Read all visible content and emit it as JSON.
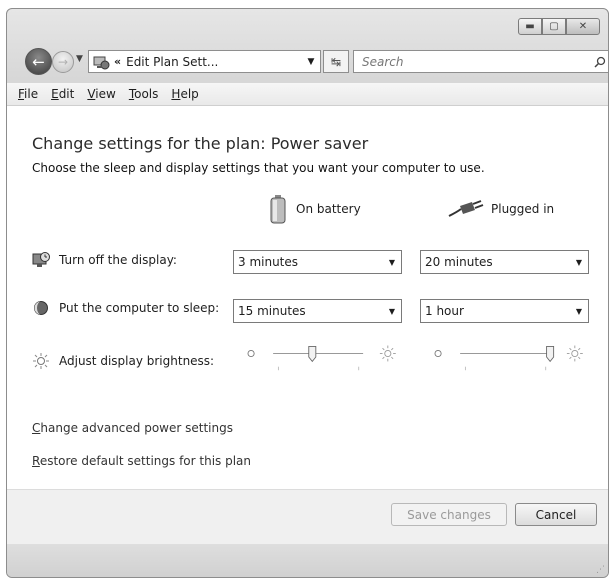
{
  "address": {
    "path_prefix": "«",
    "path": "Edit Plan Sett..."
  },
  "search": {
    "placeholder": "Search"
  },
  "menu": [
    "File",
    "Edit",
    "View",
    "Tools",
    "Help"
  ],
  "page": {
    "title": "Change settings for the plan: Power saver",
    "subtitle": "Choose the sleep and display settings that you want your computer to use."
  },
  "columns": {
    "battery": "On battery",
    "plugged": "Plugged in"
  },
  "rows": {
    "display": {
      "label": "Turn off the display:",
      "battery": "3 minutes",
      "plugged": "20 minutes"
    },
    "sleep": {
      "label": "Put the computer to sleep:",
      "battery": "15 minutes",
      "plugged": "1 hour"
    },
    "brightness": {
      "label": "Adjust display brightness:",
      "battery_level": 0.4,
      "plugged_level": 1.0
    }
  },
  "links": {
    "advanced": "Change advanced power settings",
    "restore": "Restore default settings for this plan"
  },
  "buttons": {
    "save": "Save changes",
    "cancel": "Cancel"
  }
}
